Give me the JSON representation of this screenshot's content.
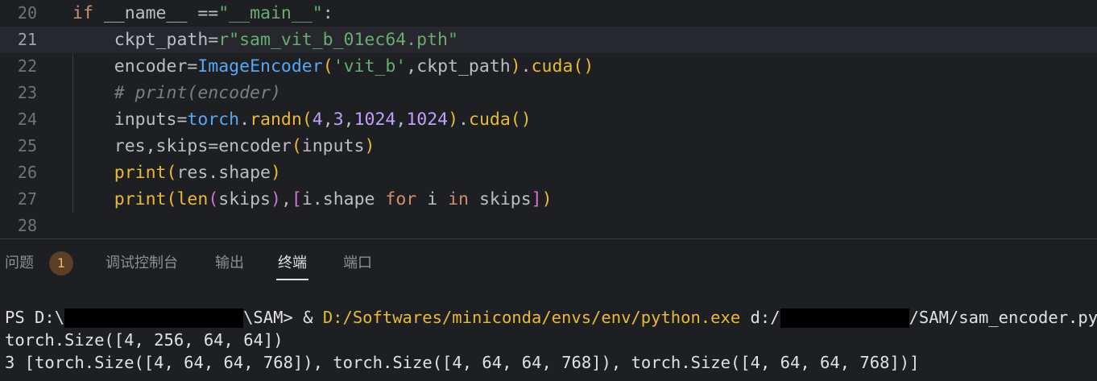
{
  "editor": {
    "lines": [
      {
        "num": "20",
        "segments": [
          {
            "t": "if",
            "c": "kw"
          },
          {
            "t": " __name__ ==",
            "c": ""
          },
          {
            "t": "\"__main__\"",
            "c": "str"
          },
          {
            "t": ":",
            "c": ""
          }
        ]
      },
      {
        "num": "21",
        "active": true,
        "segments": [
          {
            "t": "    ckpt_path=",
            "c": ""
          },
          {
            "t": "r\"sam_vit_b_01ec64.pth\"",
            "c": "str"
          }
        ]
      },
      {
        "num": "22",
        "segments": [
          {
            "t": "    encoder=",
            "c": ""
          },
          {
            "t": "ImageEncoder",
            "c": "fn"
          },
          {
            "t": "(",
            "c": "par1"
          },
          {
            "t": "'vit_b'",
            "c": "str"
          },
          {
            "t": ",ckpt_path",
            "c": ""
          },
          {
            "t": ")",
            "c": "par1"
          },
          {
            "t": ".",
            "c": ""
          },
          {
            "t": "cuda",
            "c": "meth"
          },
          {
            "t": "()",
            "c": "par1"
          }
        ]
      },
      {
        "num": "23",
        "segments": [
          {
            "t": "    # print(encoder)",
            "c": "cmt"
          }
        ]
      },
      {
        "num": "24",
        "segments": [
          {
            "t": "    inputs=",
            "c": ""
          },
          {
            "t": "torch",
            "c": "fn"
          },
          {
            "t": ".",
            "c": ""
          },
          {
            "t": "randn",
            "c": "meth"
          },
          {
            "t": "(",
            "c": "par1"
          },
          {
            "t": "4",
            "c": "num"
          },
          {
            "t": ",",
            "c": ""
          },
          {
            "t": "3",
            "c": "num"
          },
          {
            "t": ",",
            "c": ""
          },
          {
            "t": "1024",
            "c": "num"
          },
          {
            "t": ",",
            "c": ""
          },
          {
            "t": "1024",
            "c": "num"
          },
          {
            "t": ")",
            "c": "par1"
          },
          {
            "t": ".",
            "c": ""
          },
          {
            "t": "cuda",
            "c": "meth"
          },
          {
            "t": "()",
            "c": "par1"
          }
        ]
      },
      {
        "num": "25",
        "segments": [
          {
            "t": "    res,skips=encoder",
            "c": ""
          },
          {
            "t": "(",
            "c": "par1"
          },
          {
            "t": "inputs",
            "c": ""
          },
          {
            "t": ")",
            "c": "par1"
          }
        ]
      },
      {
        "num": "26",
        "segments": [
          {
            "t": "    ",
            "c": ""
          },
          {
            "t": "print",
            "c": "bi"
          },
          {
            "t": "(",
            "c": "par1"
          },
          {
            "t": "res.shape",
            "c": ""
          },
          {
            "t": ")",
            "c": "par1"
          }
        ]
      },
      {
        "num": "27",
        "segments": [
          {
            "t": "    ",
            "c": ""
          },
          {
            "t": "print",
            "c": "bi"
          },
          {
            "t": "(",
            "c": "par1"
          },
          {
            "t": "len",
            "c": "bi"
          },
          {
            "t": "(",
            "c": "par2"
          },
          {
            "t": "skips",
            "c": ""
          },
          {
            "t": ")",
            "c": "par2"
          },
          {
            "t": ",",
            "c": ""
          },
          {
            "t": "[",
            "c": "par2"
          },
          {
            "t": "i.shape ",
            "c": ""
          },
          {
            "t": "for",
            "c": "kw"
          },
          {
            "t": " i ",
            "c": ""
          },
          {
            "t": "in",
            "c": "kw"
          },
          {
            "t": " skips",
            "c": ""
          },
          {
            "t": "]",
            "c": "par2"
          },
          {
            "t": ")",
            "c": "par1"
          }
        ]
      },
      {
        "num": "28",
        "segments": []
      }
    ]
  },
  "panel": {
    "tabs": [
      {
        "label": "问题",
        "active": false
      },
      {
        "label": "调试控制台",
        "active": false
      },
      {
        "label": "输出",
        "active": false
      },
      {
        "label": "终端",
        "active": true
      },
      {
        "label": "端口",
        "active": false
      }
    ],
    "problems_count": "1"
  },
  "terminal": {
    "prompt_start": "PS D:\\",
    "prompt_end": "\\SAM> ",
    "command_amp": "& ",
    "python_path": "D:/Softwares/miniconda/envs/env/python.exe",
    "script_prefix": " d:/",
    "script_suffix": "/SAM/sam_encoder.py",
    "output_line1": "torch.Size([4, 256, 64, 64])",
    "output_line2": "3 [torch.Size([4, 64, 64, 768]), torch.Size([4, 64, 64, 768]), torch.Size([4, 64, 64, 768])]"
  },
  "colors": {
    "background": "#1e1f22",
    "keyword": "#cf8e6d",
    "string": "#6aab73",
    "number": "#c0a1f7",
    "function": "#56a8f5",
    "builtin": "#e8ba36"
  }
}
